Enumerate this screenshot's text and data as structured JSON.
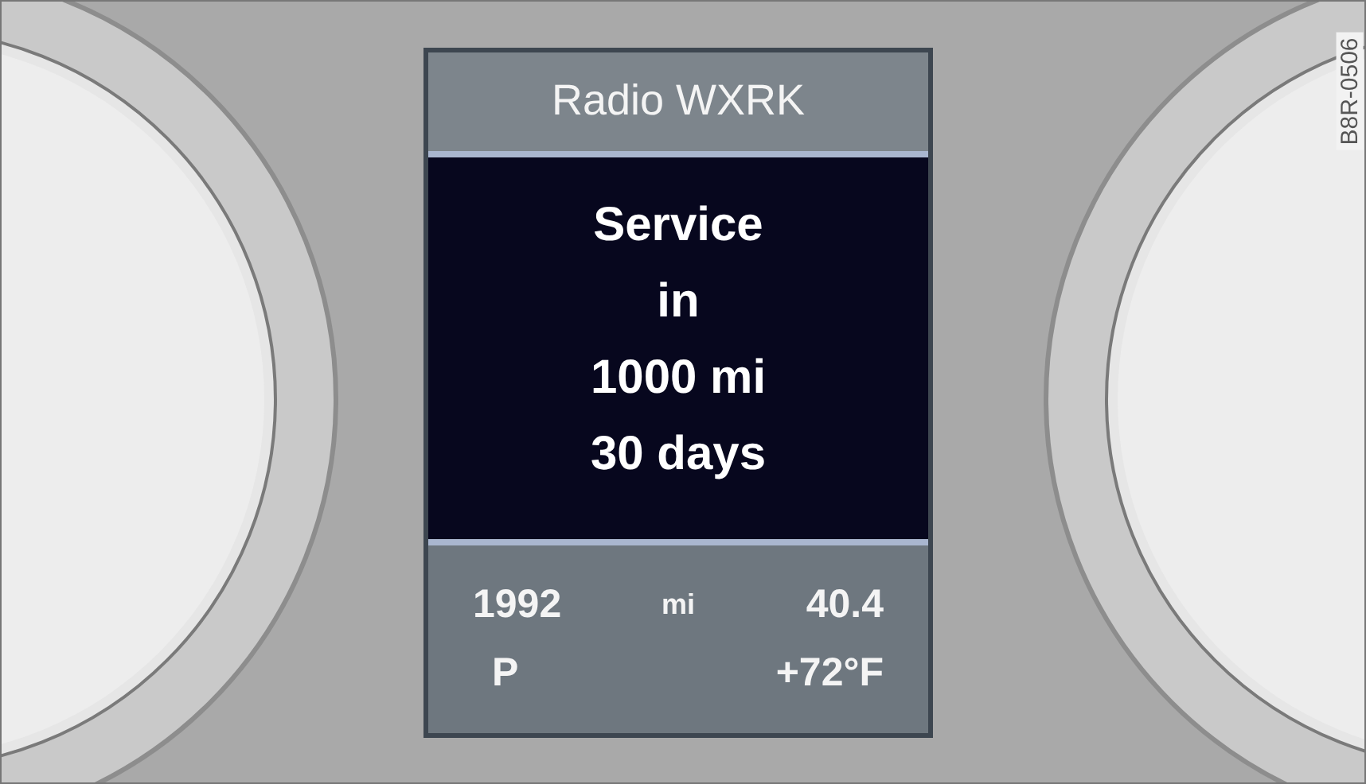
{
  "header": {
    "title": "Radio WXRK"
  },
  "message": {
    "lines": [
      "Service",
      "in",
      "1000 mi",
      "30 days"
    ]
  },
  "status": {
    "odometer": "1992",
    "unit": "mi",
    "reading": "40.4",
    "gear": "P",
    "temperature": "+72°F"
  },
  "figure_code": "B8R-0506"
}
